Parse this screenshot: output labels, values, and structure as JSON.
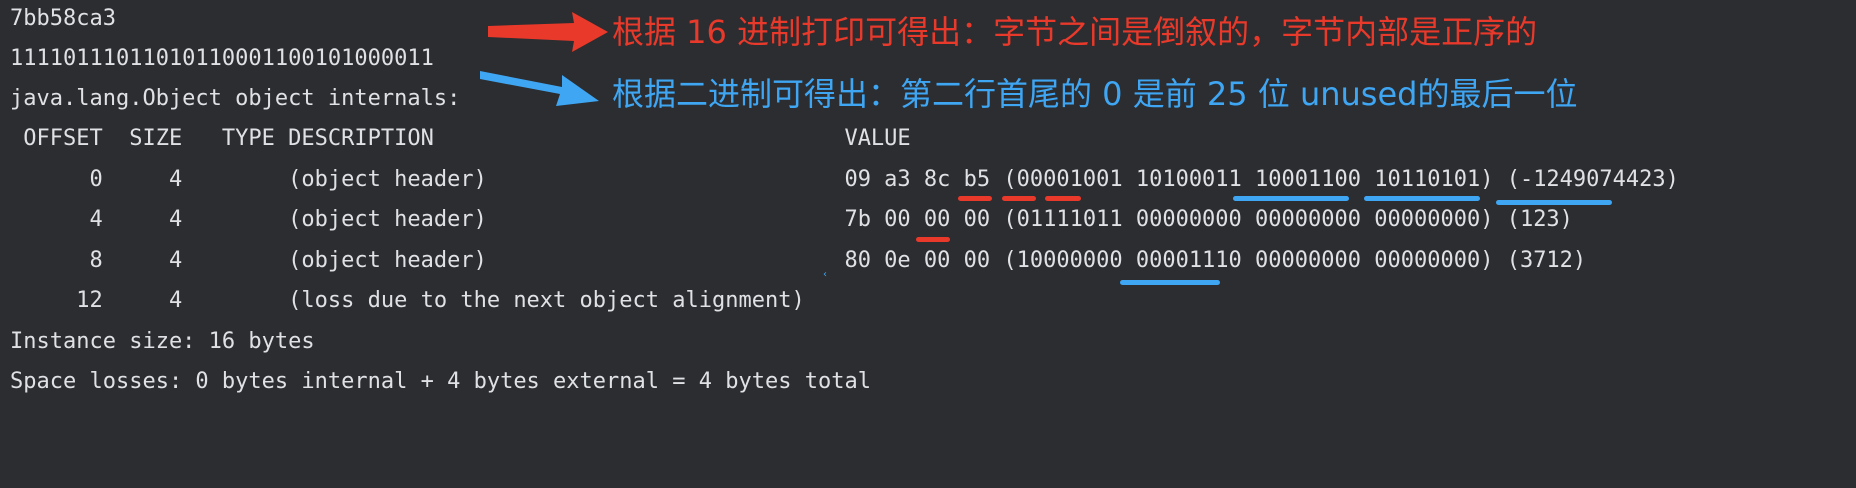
{
  "console": {
    "hex_line": "7bb58ca3",
    "bin_line": "11110111011010110001100101000011",
    "title_line": "java.lang.Object object internals:",
    "header_line": " OFFSET  SIZE   TYPE DESCRIPTION                               VALUE",
    "rows": [
      "      0     4        (object header)                           09 a3 8c b5 (00001001 10100011 10001100 10110101) (-1249074423)",
      "      4     4        (object header)                           7b 00 00 00 (01111011 00000000 00000000 00000000) (123)",
      "      8     4        (object header)                           80 0e 00 00 (10000000 00001110 00000000 00000000) (3712)",
      "     12     4        (loss due to the next object alignment)"
    ],
    "instance_size": "Instance size: 16 bytes",
    "space_losses": "Space losses: 0 bytes internal + 4 bytes external = 4 bytes total"
  },
  "annotations": {
    "red_note": "根据 16 进制打印可得出：字节之间是倒叙的，字节内部是正序的",
    "blue_note": "根据二进制可得出：第二行首尾的 0 是前 25 位 unused的最后一位"
  },
  "colors": {
    "background": "#2b2d30",
    "text": "#dfe1e5",
    "red": "#e8392b",
    "blue": "#3fa6f4"
  }
}
